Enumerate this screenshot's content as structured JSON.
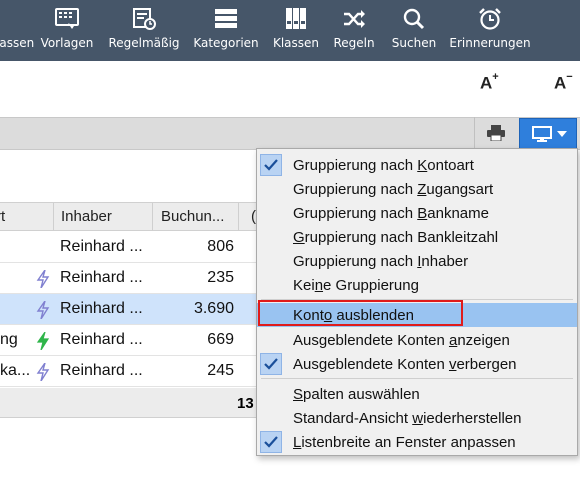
{
  "toolbar": {
    "items": [
      {
        "label": "lassen",
        "icon": "accounts-icon"
      },
      {
        "label": "Vorlagen",
        "icon": "template-icon"
      },
      {
        "label": "Regelmäßig",
        "icon": "recurring-icon"
      },
      {
        "label": "Kategorien",
        "icon": "categories-icon"
      },
      {
        "label": "Klassen",
        "icon": "classes-icon"
      },
      {
        "label": "Regeln",
        "icon": "shuffle-icon"
      },
      {
        "label": "Suchen",
        "icon": "search-icon"
      },
      {
        "label": "Erinnerungen",
        "icon": "alarm-clock-icon"
      }
    ]
  },
  "fontsize": {
    "increase": "A",
    "decrease": "A",
    "plus": "+",
    "minus": "−"
  },
  "table": {
    "headers": [
      "rt",
      "Inhaber",
      "Buchun...",
      "("
    ],
    "rows": [
      {
        "art": "",
        "bolt": false,
        "inhaber": "Reinhard ...",
        "buchungen": "806"
      },
      {
        "art": "",
        "bolt": true,
        "bolt_color": "#8080d0",
        "inhaber": "Reinhard ...",
        "buchungen": "235"
      },
      {
        "art": "",
        "bolt": true,
        "bolt_color": "#8080d0",
        "inhaber": "Reinhard ...",
        "buchungen": "3.690"
      },
      {
        "art": "ng",
        "bolt": true,
        "bolt_color": "#2fb54a",
        "inhaber": "Reinhard ...",
        "buchungen": "669"
      },
      {
        "art": "ka...",
        "bolt": true,
        "bolt_color": "#8080d0",
        "inhaber": "Reinhard ...",
        "buchungen": "245"
      }
    ],
    "total": "13"
  },
  "menu": {
    "items": [
      {
        "pre": "Gruppierung nach ",
        "u": "K",
        "post": "ontoart",
        "checked": true
      },
      {
        "pre": "Gruppierung nach ",
        "u": "Z",
        "post": "ugangsart",
        "checked": false
      },
      {
        "pre": "Gruppierung nach ",
        "u": "B",
        "post": "ankname",
        "checked": false
      },
      {
        "pre": "",
        "u": "G",
        "post": "ruppierung nach Bankleitzahl",
        "checked": false
      },
      {
        "pre": "Gruppierung nach ",
        "u": "I",
        "post": "nhaber",
        "checked": false
      },
      {
        "pre": "Kei",
        "u": "n",
        "post": "e Gruppierung",
        "checked": false
      },
      {
        "pre": "Kont",
        "u": "o",
        "post": " ausblenden",
        "checked": false,
        "highlighted": true
      },
      {
        "pre": "Ausgeblendete Konten ",
        "u": "a",
        "post": "nzeigen",
        "checked": false
      },
      {
        "pre": "Ausgeblendete Konten ",
        "u": "v",
        "post": "erbergen",
        "checked": true
      },
      {
        "pre": "",
        "u": "S",
        "post": "palten auswählen",
        "checked": false
      },
      {
        "pre": "Standard-Ansicht ",
        "u": "w",
        "post": "iederherstellen",
        "checked": false
      },
      {
        "pre": "",
        "u": "L",
        "post": "istenbreite an Fenster anpassen",
        "checked": true
      }
    ]
  }
}
